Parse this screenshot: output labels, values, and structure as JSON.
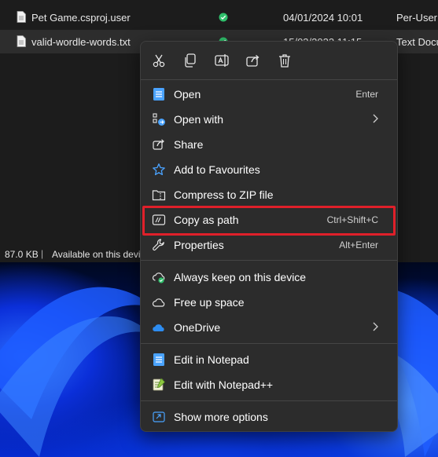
{
  "files": [
    {
      "name": "Pet Game.csproj.user",
      "date": "04/01/2024 10:01",
      "type": "Per-User P",
      "status": "synced",
      "selected": false
    },
    {
      "name": "valid-wordle-words.txt",
      "date": "15/03/2023 11:15",
      "type": "Text Docu",
      "status": "synced",
      "selected": true
    }
  ],
  "statusbar": {
    "size": "87.0 KB",
    "separator": "|",
    "availability": "Available on this devi"
  },
  "context_menu": {
    "toolbar": [
      {
        "icon": "cut-icon"
      },
      {
        "icon": "copy-icon"
      },
      {
        "icon": "rename-icon"
      },
      {
        "icon": "share-icon"
      },
      {
        "icon": "delete-icon"
      }
    ],
    "items": [
      {
        "label": "Open",
        "shortcut": "Enter",
        "icon": "notepad-icon"
      },
      {
        "label": "Open with",
        "shortcut": "",
        "icon": "open-with-icon",
        "submenu": true
      },
      {
        "label": "Share",
        "shortcut": "",
        "icon": "share-icon"
      },
      {
        "label": "Add to Favourites",
        "shortcut": "",
        "icon": "star-icon"
      },
      {
        "label": "Compress to ZIP file",
        "shortcut": "",
        "icon": "zip-icon"
      },
      {
        "label": "Copy as path",
        "shortcut": "Ctrl+Shift+C",
        "icon": "copy-path-icon",
        "highlighted": true
      },
      {
        "label": "Properties",
        "shortcut": "Alt+Enter",
        "icon": "wrench-icon"
      },
      {
        "label": "Always keep on this device",
        "shortcut": "",
        "icon": "cloud-keep-icon"
      },
      {
        "label": "Free up space",
        "shortcut": "",
        "icon": "cloud-icon"
      },
      {
        "label": "OneDrive",
        "shortcut": "",
        "icon": "onedrive-icon",
        "submenu": true
      },
      {
        "label": "Edit in Notepad",
        "shortcut": "",
        "icon": "notepad-icon"
      },
      {
        "label": "Edit with Notepad++",
        "shortcut": "",
        "icon": "notepadpp-icon"
      },
      {
        "label": "Show more options",
        "shortcut": "",
        "icon": "show-more-icon"
      }
    ]
  },
  "colors": {
    "menu_bg": "#2c2c2c",
    "highlight_border": "#e0202a",
    "accent": "#4cc2ff",
    "status_green": "#2fbf6b"
  }
}
